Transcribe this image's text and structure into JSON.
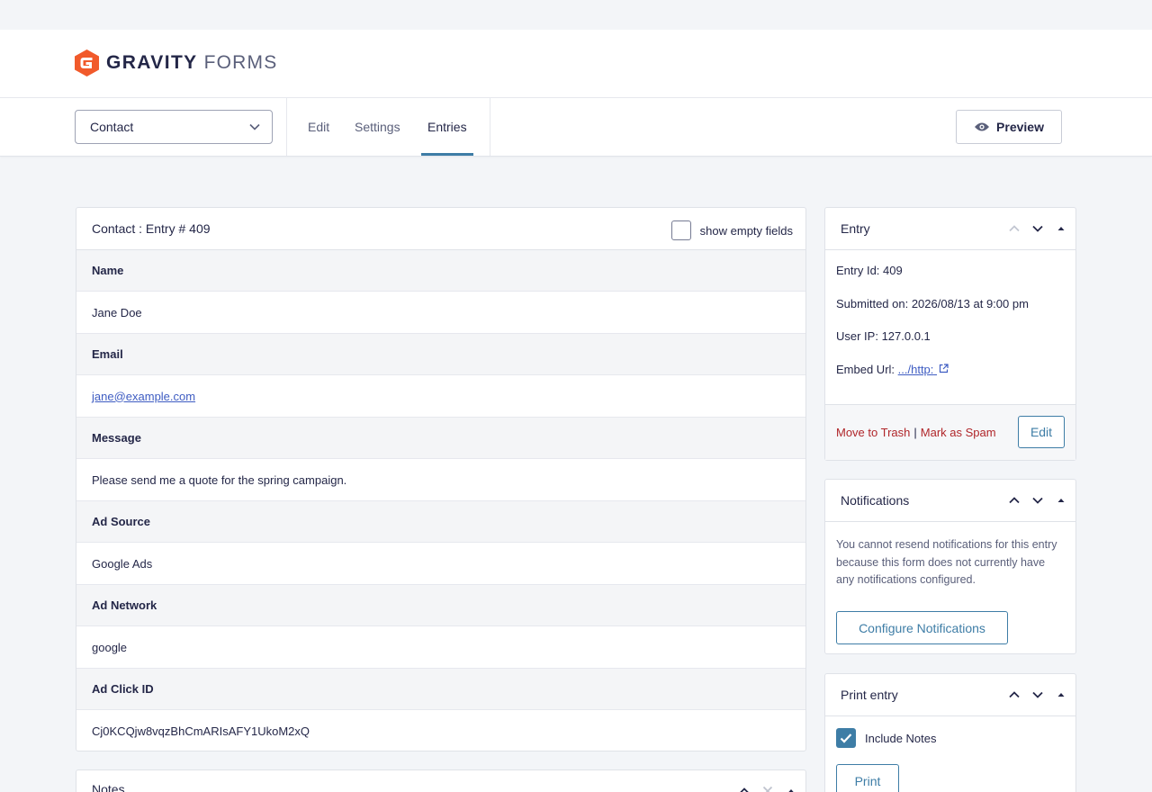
{
  "brand": {
    "word1": "GRAVITY",
    "word2": "FORMS",
    "accent": "#f15a2b"
  },
  "toolbar": {
    "form_selector_value": "Contact",
    "tabs": [
      {
        "label": "Edit"
      },
      {
        "label": "Settings"
      },
      {
        "label": "Entries",
        "active": true
      }
    ],
    "preview_label": "Preview"
  },
  "entry_detail": {
    "title": "Contact : Entry # 409",
    "show_empty_label": "show empty fields",
    "fields": [
      {
        "label": "Name",
        "value": "Jane Doe"
      },
      {
        "label": "Email",
        "value": "jane@example.com",
        "link": true
      },
      {
        "label": "Message",
        "value": "Please send me a quote for the spring campaign."
      },
      {
        "label": "Ad Source",
        "value": "Google Ads"
      },
      {
        "label": "Ad Network",
        "value": "google"
      },
      {
        "label": "Ad Click ID",
        "value": "Cj0KCQjw8vqzBhCmARIsAFY1UkoM2xQ"
      }
    ]
  },
  "notes_box": {
    "title": "Notes"
  },
  "entry_box": {
    "title": "Entry",
    "entry_id": "Entry Id: 409",
    "submitted": "Submitted on: 2026/08/13 at 9:00 pm",
    "user_ip": "User IP: 127.0.0.1",
    "embed_label": "Embed Url:",
    "embed_link": ".../http:",
    "trash": "Move to Trash",
    "separator": "|",
    "spam": "Mark as Spam",
    "edit": "Edit"
  },
  "notifications_box": {
    "title": "Notifications",
    "message": "You cannot resend notifications for this entry because this form does not currently have any notifications configured.",
    "button": "Configure Notifications"
  },
  "print_box": {
    "title": "Print entry",
    "include_notes": "Include Notes",
    "include_notes_checked": true,
    "button": "Print"
  },
  "colors": {
    "primary": "#3e7da6",
    "danger": "#b0262a",
    "link": "#3e5cc2"
  }
}
